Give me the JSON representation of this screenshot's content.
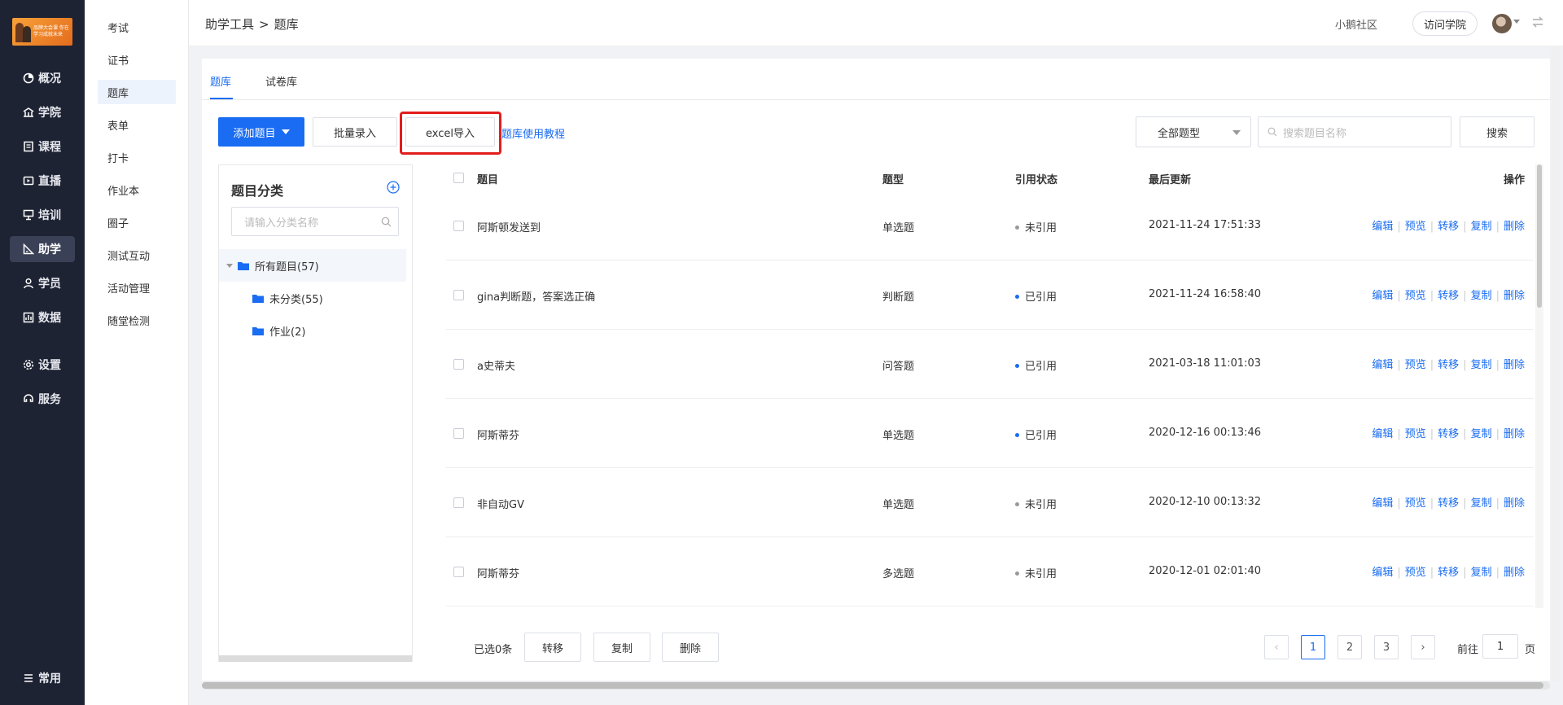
{
  "nav": {
    "logo_text": "品牌大会课\n你在学习成就未来",
    "items": [
      {
        "label": "概况",
        "icon": "pie-chart-icon"
      },
      {
        "label": "学院",
        "icon": "college-icon"
      },
      {
        "label": "课程",
        "icon": "book-icon"
      },
      {
        "label": "直播",
        "icon": "live-icon"
      },
      {
        "label": "培训",
        "icon": "training-icon"
      },
      {
        "label": "助学",
        "icon": "ruler-icon"
      },
      {
        "label": "学员",
        "icon": "user-icon"
      },
      {
        "label": "数据",
        "icon": "data-icon"
      },
      {
        "label": "设置",
        "icon": "gear-icon"
      },
      {
        "label": "服务",
        "icon": "service-icon"
      }
    ],
    "bottom_label": "常用"
  },
  "subnav": {
    "items": [
      "考试",
      "证书",
      "题库",
      "表单",
      "打卡",
      "作业本",
      "圈子",
      "测试互动",
      "活动管理",
      "随堂检测"
    ]
  },
  "topbar": {
    "crumb_parent": "助学工具",
    "crumb_sep": ">",
    "crumb_current": "题库",
    "community": "小鹅社区",
    "visit_button": "访问学院"
  },
  "tabs": [
    "题库",
    "试卷库"
  ],
  "toolbar": {
    "add_label": "添加题目",
    "batch_label": "批量录入",
    "excel_label": "excel导入",
    "tutorial_label": "题库使用教程",
    "type_select": "全部题型",
    "search_placeholder": "搜索题目名称",
    "search_button": "搜索"
  },
  "categories": {
    "title": "题目分类",
    "search_placeholder": "请输入分类名称",
    "tree": [
      {
        "label": "所有题目(57)"
      },
      {
        "label": "未分类(55)"
      },
      {
        "label": "作业(2)"
      }
    ]
  },
  "table": {
    "columns": [
      "题目",
      "题型",
      "引用状态",
      "最后更新",
      "操作"
    ],
    "rows": [
      {
        "title": "阿斯顿发送到",
        "type": "单选题",
        "status": "未引用",
        "updated": "2021-11-24 17:51:33"
      },
      {
        "title": "gina判断题，答案选正确",
        "type": "判断题",
        "status": "已引用",
        "updated": "2021-11-24 16:58:40"
      },
      {
        "title": "a史蒂夫",
        "type": "问答题",
        "status": "已引用",
        "updated": "2021-03-18 11:01:03"
      },
      {
        "title": "阿斯蒂芬",
        "type": "单选题",
        "status": "已引用",
        "updated": "2020-12-16 00:13:46"
      },
      {
        "title": "非自动GV",
        "type": "单选题",
        "status": "未引用",
        "updated": "2020-12-10 00:13:32"
      },
      {
        "title": "阿斯蒂芬",
        "type": "多选题",
        "status": "未引用",
        "updated": "2020-12-01 02:01:40"
      }
    ],
    "ops": [
      "编辑",
      "预览",
      "转移",
      "复制",
      "删除"
    ]
  },
  "footer": {
    "selected": "已选0条",
    "move": "转移",
    "copy": "复制",
    "delete": "删除",
    "pages": [
      "1",
      "2",
      "3"
    ],
    "goto_prefix": "前往",
    "goto_value": "1",
    "goto_suffix": "页"
  },
  "colors": {
    "accent": "#1a6cf2",
    "nav_bg": "#1e2334",
    "highlight": "#e31c1c",
    "status_used": "#1a6cf2",
    "status_unused": "#999999"
  }
}
